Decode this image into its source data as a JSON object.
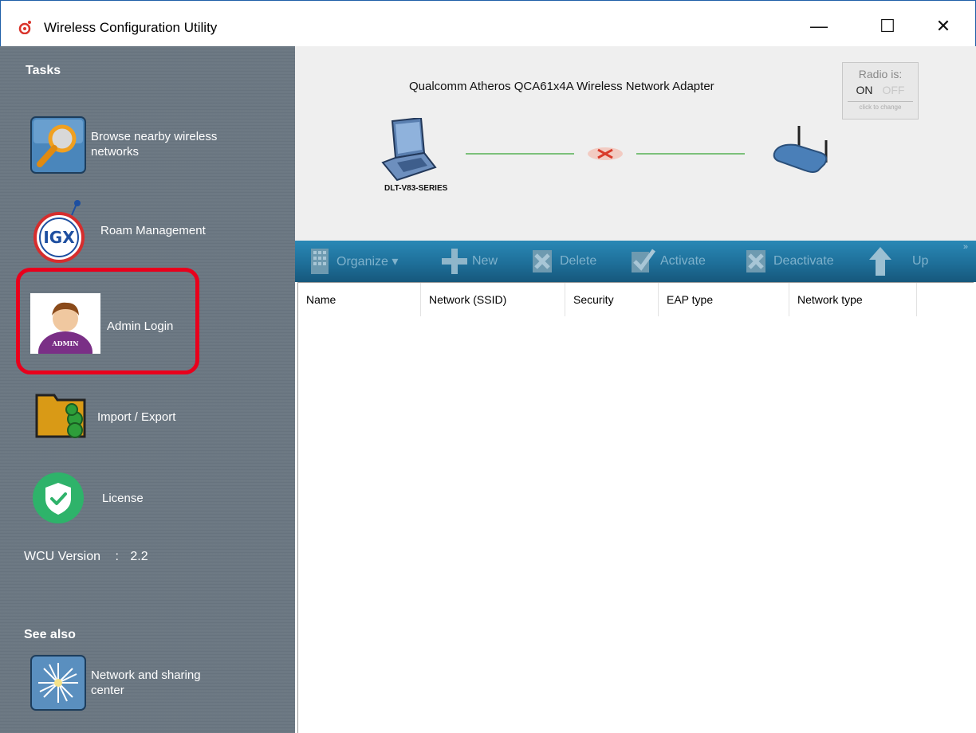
{
  "window": {
    "title": "Wireless Configuration Utility",
    "minimize": "—",
    "maximize": "☐",
    "close": "✕"
  },
  "sidebar": {
    "tasks_heading": "Tasks",
    "items": [
      {
        "label": "Browse nearby wireless networks",
        "icon": "magnifier-icon"
      },
      {
        "label": "Roam Management",
        "icon": "igx-roam-icon"
      },
      {
        "label": "Admin Login",
        "icon": "admin-user-icon",
        "icon_text": "ADMIN"
      },
      {
        "label": "Import / Export",
        "icon": "folder-icon"
      },
      {
        "label": "License",
        "icon": "shield-check-icon"
      }
    ],
    "version_label": "WCU Version",
    "version_sep": ":",
    "version_value": "2.2",
    "see_also_heading": "See also",
    "see_also_items": [
      {
        "label": "Network and sharing center",
        "icon": "network-star-icon"
      }
    ]
  },
  "banner": {
    "adapter_name": "Qualcomm Atheros QCA61x4A Wireless Network Adapter",
    "laptop_label": "DLT-V83-SERIES",
    "radio": {
      "title": "Radio is:",
      "on": "ON",
      "off": "OFF",
      "hint": "click to change"
    }
  },
  "toolbar": {
    "buttons": [
      {
        "label": "Organize ▾"
      },
      {
        "label": "New"
      },
      {
        "label": "Delete"
      },
      {
        "label": "Activate"
      },
      {
        "label": "Deactivate"
      },
      {
        "label": "Up"
      }
    ],
    "more": "»"
  },
  "list": {
    "columns": [
      "Name",
      "Network (SSID)",
      "Security",
      "EAP type",
      "Network type"
    ],
    "rows": []
  },
  "colors": {
    "sidebar_bg": "#6b7782",
    "toolbar_bg": "#1e6f99",
    "highlight": "#e8001c",
    "link_line": "#7cc07a"
  }
}
